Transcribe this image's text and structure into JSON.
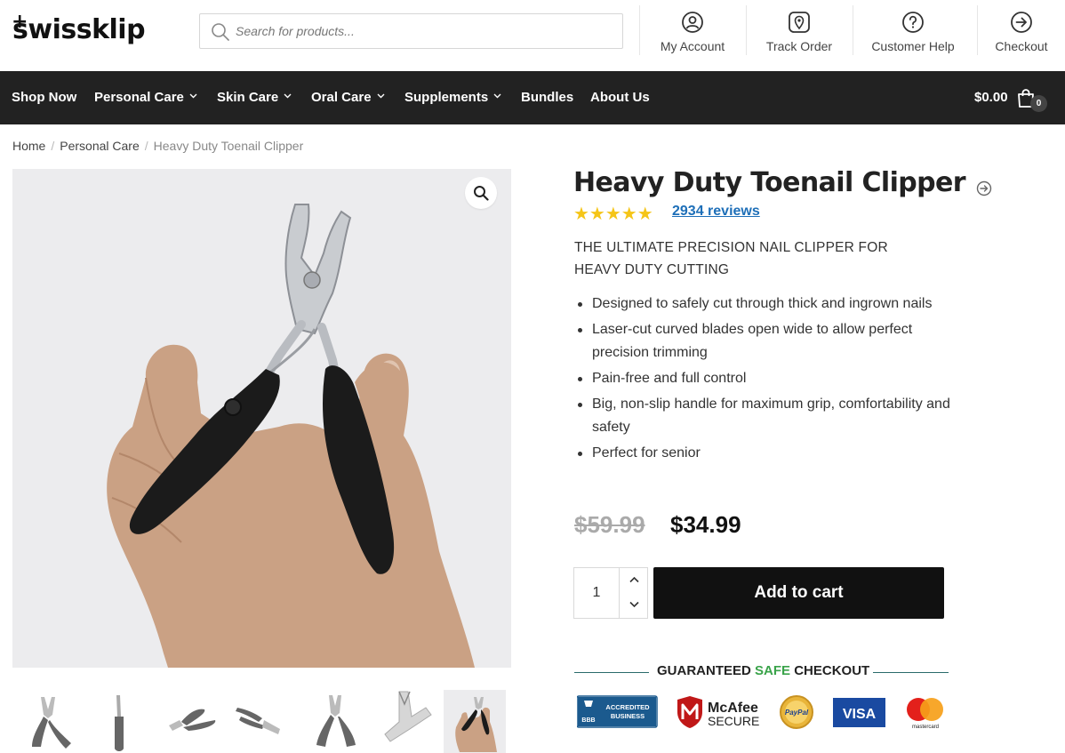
{
  "header": {
    "logo": "swissklip",
    "search_placeholder": "Search for products...",
    "links": [
      {
        "label": "My Account",
        "icon": "account-icon"
      },
      {
        "label": "Track Order",
        "icon": "location-pin-icon"
      },
      {
        "label": "Customer Help",
        "icon": "question-icon"
      },
      {
        "label": "Checkout",
        "icon": "arrow-right-circle-icon"
      }
    ]
  },
  "nav": {
    "items": [
      {
        "label": "Shop Now",
        "dropdown": false
      },
      {
        "label": "Personal Care",
        "dropdown": true
      },
      {
        "label": "Skin Care",
        "dropdown": true
      },
      {
        "label": "Oral Care",
        "dropdown": true
      },
      {
        "label": "Supplements",
        "dropdown": true
      },
      {
        "label": "Bundles",
        "dropdown": false
      },
      {
        "label": "About Us",
        "dropdown": false
      }
    ],
    "cart_total": "$0.00",
    "cart_count": "0"
  },
  "breadcrumb": {
    "home": "Home",
    "category": "Personal Care",
    "current": "Heavy Duty Toenail Clipper"
  },
  "product": {
    "title": "Heavy Duty Toenail Clipper",
    "rating": 5,
    "stars": "★★★★★",
    "reviews": "2934 reviews",
    "tagline": "THE ULTIMATE PRECISION NAIL CLIPPER FOR HEAVY DUTY CUTTING",
    "features": [
      "Designed to safely cut through thick and ingrown nails",
      "Laser-cut curved blades open wide to allow perfect precision trimming",
      "Pain-free and full control",
      "Big, non-slip handle for maximum grip, comfortability and safety",
      "Perfect for senior"
    ],
    "old_price": "$59.99",
    "price": "$34.99",
    "quantity": "1",
    "add_to_cart": "Add to cart",
    "thumbnail_count": 7
  },
  "checkout": {
    "guaranteed": "GUARANTEED",
    "safe": "SAFE",
    "checkout_word": "CHECKOUT",
    "badges": {
      "bbb_line1": "ACCREDITED",
      "bbb_line2": "BUSINESS",
      "bbb_mark": "BBB",
      "mcafee_line1": "McAfee",
      "mcafee_line2": "SECURE",
      "paypal": "PayPal",
      "visa": "VISA",
      "mastercard": "mastercard"
    }
  },
  "colors": {
    "nav_bg": "#222222",
    "link_blue": "#1e6fb8",
    "star_gold": "#f5c518",
    "safe_green": "#3aa34a"
  }
}
